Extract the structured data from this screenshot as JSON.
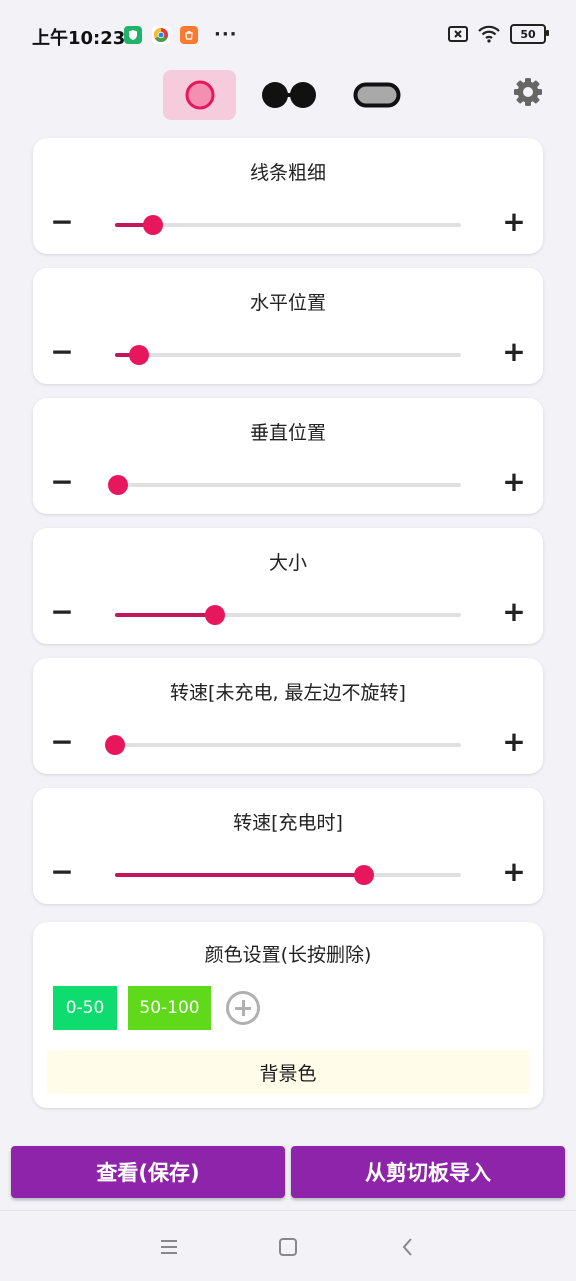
{
  "status_bar": {
    "time": "上午10:23",
    "more": "···",
    "battery": "50",
    "icons": [
      "shield-app-icon",
      "chrome-app-icon",
      "shop-app-icon",
      "sim-off-icon",
      "wifi-icon",
      "battery-icon"
    ]
  },
  "modes": [
    {
      "name": "ring",
      "active": true
    },
    {
      "name": "glasses",
      "active": false
    },
    {
      "name": "pill",
      "active": false
    }
  ],
  "sliders": [
    {
      "title": "线条粗细",
      "value": 0.11
    },
    {
      "title": "水平位置",
      "value": 0.07
    },
    {
      "title": "垂直位置",
      "value": 0.01
    },
    {
      "title": "大小",
      "value": 0.29
    },
    {
      "title": "转速[未充电, 最左边不旋转]",
      "value": 0.0
    },
    {
      "title": "转速[充电时]",
      "value": 0.72
    }
  ],
  "color_settings": {
    "title": "颜色设置(长按删除)",
    "chips": [
      {
        "label": "0-50",
        "color": "#0fdc6e"
      },
      {
        "label": "50-100",
        "color": "#5fd91a"
      }
    ],
    "background_label": "背景色"
  },
  "actions": {
    "view_save": "查看(保存)",
    "import_clipboard": "从剪切板导入"
  },
  "colors": {
    "accent": "#e8175d",
    "fill": "#c2185b",
    "button": "#8e24aa",
    "active_tab": "#f6cbdc"
  }
}
